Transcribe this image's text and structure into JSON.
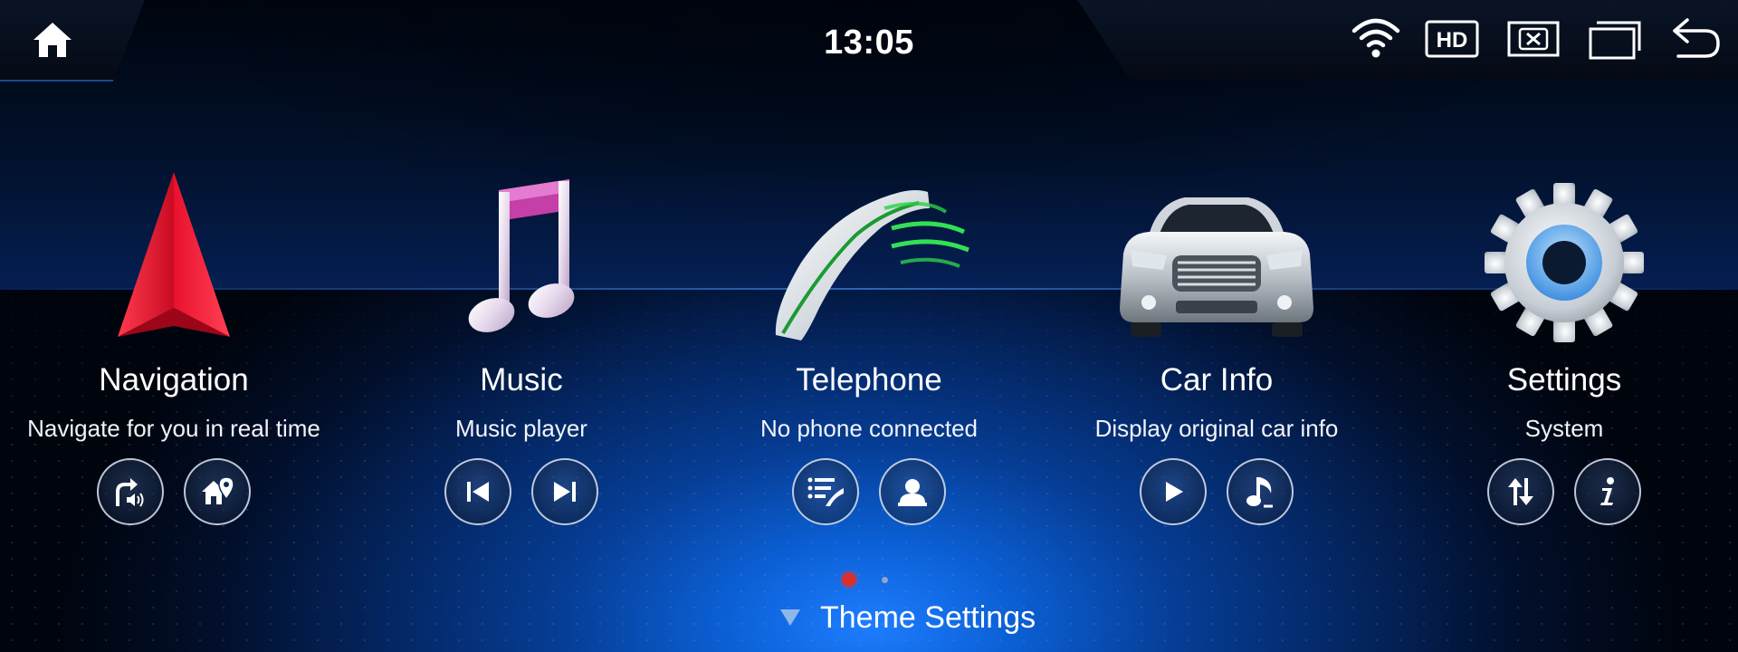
{
  "status_bar": {
    "time": "13:05",
    "icons": [
      "home-icon",
      "wifi-icon",
      "hd-icon",
      "close-window-icon",
      "multi-window-icon",
      "back-icon"
    ],
    "hd_label": "HD"
  },
  "apps": [
    {
      "title": "Navigation",
      "subtitle": "Navigate for you in real time",
      "hero_icon": "navigation-arrow-icon",
      "actions": [
        "voice-guidance-icon",
        "home-location-icon"
      ]
    },
    {
      "title": "Music",
      "subtitle": "Music player",
      "hero_icon": "music-note-icon",
      "actions": [
        "previous-track-icon",
        "next-track-icon"
      ]
    },
    {
      "title": "Telephone",
      "subtitle": "No phone connected",
      "hero_icon": "phone-handset-icon",
      "actions": [
        "call-log-icon",
        "contacts-icon"
      ]
    },
    {
      "title": "Car Info",
      "subtitle": "Display original car info",
      "hero_icon": "car-icon",
      "actions": [
        "play-icon",
        "car-music-icon"
      ]
    },
    {
      "title": "Settings",
      "subtitle": "System",
      "hero_icon": "gear-icon",
      "actions": [
        "sort-icon",
        "info-icon"
      ]
    }
  ],
  "pagination": {
    "current": 1,
    "total": 2
  },
  "footer": {
    "theme_settings_label": "Theme Settings"
  },
  "colors": {
    "accent_blue": "#1e7dff",
    "page_dot_active": "#d8302f",
    "navigation_red": "#e8112d"
  }
}
